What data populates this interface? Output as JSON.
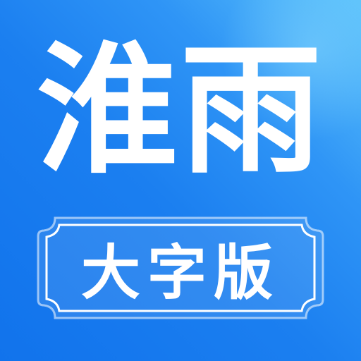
{
  "app_icon": {
    "title": "淮雨",
    "badge_label": "大字版",
    "colors": {
      "gradient_start": "#5cc2fb",
      "gradient_end": "#1173ec",
      "text": "#ffffff",
      "badge_border": "#ffffff"
    }
  }
}
